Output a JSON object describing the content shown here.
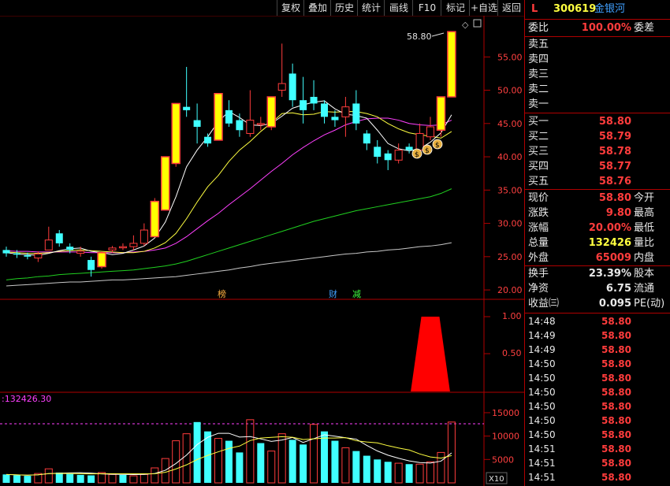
{
  "toolbar": {
    "buttons": [
      "复权",
      "叠加",
      "历史",
      "统计",
      "画线",
      "F10",
      "标记",
      "+自选",
      "返回"
    ]
  },
  "chart": {
    "price_axis": [
      "55.00",
      "50.00",
      "45.00",
      "40.00",
      "35.00",
      "30.00",
      "25.00",
      "20.00"
    ],
    "max_label": "58.80",
    "markers": [
      "榜",
      "财",
      "减"
    ],
    "indicator_axis": [
      "1.00",
      "0.50"
    ],
    "volume_label": ":132426.30",
    "volume_axis": [
      "15000",
      "10000",
      "5000"
    ],
    "volume_unit": "X10",
    "colors": {
      "up": "#ff3c3c",
      "down": "#40ffff",
      "limit_up": "#ffff00",
      "ma5": "#ffffff",
      "ma10": "#ffff40",
      "ma20": "#ff40ff",
      "ma60": "#20d020",
      "ma120": "#c8c8c8"
    }
  },
  "chart_data": {
    "type": "candlestick",
    "y_range": [
      18,
      60
    ],
    "candles": [
      {
        "o": 26.0,
        "c": 25.5,
        "h": 26.5,
        "l": 25.0
      },
      {
        "o": 25.5,
        "c": 25.3,
        "h": 26.0,
        "l": 24.8
      },
      {
        "o": 25.2,
        "c": 25.0,
        "h": 25.6,
        "l": 24.6
      },
      {
        "o": 24.8,
        "c": 25.4,
        "h": 25.8,
        "l": 24.2
      },
      {
        "o": 26.0,
        "c": 27.5,
        "h": 29.5,
        "l": 26.0
      },
      {
        "o": 28.5,
        "c": 27.0,
        "h": 29.0,
        "l": 26.5
      },
      {
        "o": 26.5,
        "c": 26.0,
        "h": 27.0,
        "l": 25.5
      },
      {
        "o": 25.5,
        "c": 25.8,
        "h": 26.5,
        "l": 25.0
      },
      {
        "o": 24.5,
        "c": 23.0,
        "h": 25.0,
        "l": 22.0
      },
      {
        "o": 23.5,
        "c": 25.6,
        "h": 25.8,
        "l": 23.2,
        "limit": true
      },
      {
        "o": 26.0,
        "c": 26.3,
        "h": 26.6,
        "l": 25.6
      },
      {
        "o": 26.5,
        "c": 26.5,
        "h": 27.0,
        "l": 26.0
      },
      {
        "o": 26.5,
        "c": 27.0,
        "h": 28.2,
        "l": 26.0
      },
      {
        "o": 27.0,
        "c": 29.0,
        "h": 30.0,
        "l": 26.6
      },
      {
        "o": 28.0,
        "c": 33.3,
        "h": 33.8,
        "l": 28.0,
        "limit": true
      },
      {
        "o": 32.0,
        "c": 40.0,
        "h": 40.0,
        "l": 32.0,
        "limit": true
      },
      {
        "o": 39.0,
        "c": 48.0,
        "h": 48.0,
        "l": 38.5,
        "limit": true
      },
      {
        "o": 47.5,
        "c": 47.0,
        "h": 53.5,
        "l": 46.0
      },
      {
        "o": 45.5,
        "c": 44.5,
        "h": 48.0,
        "l": 42.0
      },
      {
        "o": 43.0,
        "c": 42.0,
        "h": 43.5,
        "l": 41.5
      },
      {
        "o": 42.5,
        "c": 49.5,
        "h": 49.5,
        "l": 42.5,
        "limit": true
      },
      {
        "o": 47.0,
        "c": 45.0,
        "h": 48.5,
        "l": 44.5
      },
      {
        "o": 45.5,
        "c": 44.0,
        "h": 46.5,
        "l": 43.0
      },
      {
        "o": 43.5,
        "c": 45.5,
        "h": 50.0,
        "l": 43.0
      },
      {
        "o": 45.0,
        "c": 45.0,
        "h": 46.0,
        "l": 44.0
      },
      {
        "o": 44.5,
        "c": 49.0,
        "h": 49.0,
        "l": 44.0,
        "limit": true
      },
      {
        "o": 50.0,
        "c": 51.0,
        "h": 57.0,
        "l": 49.0
      },
      {
        "o": 52.5,
        "c": 48.5,
        "h": 54.0,
        "l": 47.5
      },
      {
        "o": 48.5,
        "c": 47.0,
        "h": 52.0,
        "l": 45.0
      },
      {
        "o": 49.0,
        "c": 48.0,
        "h": 51.5,
        "l": 47.0
      },
      {
        "o": 48.0,
        "c": 46.0,
        "h": 48.5,
        "l": 45.0
      },
      {
        "o": 46.0,
        "c": 45.5,
        "h": 47.0,
        "l": 44.5
      },
      {
        "o": 46.0,
        "c": 47.5,
        "h": 49.0,
        "l": 43.0
      },
      {
        "o": 48.0,
        "c": 45.0,
        "h": 50.0,
        "l": 44.0
      },
      {
        "o": 43.5,
        "c": 42.0,
        "h": 44.0,
        "l": 41.0
      },
      {
        "o": 41.5,
        "c": 40.0,
        "h": 42.5,
        "l": 39.0
      },
      {
        "o": 40.5,
        "c": 39.5,
        "h": 41.0,
        "l": 38.0
      },
      {
        "o": 39.5,
        "c": 41.0,
        "h": 42.0,
        "l": 39.0
      },
      {
        "o": 41.5,
        "c": 41.0,
        "h": 42.0,
        "l": 40.5
      },
      {
        "o": 41.0,
        "c": 43.5,
        "h": 45.0,
        "l": 40.5
      },
      {
        "o": 43.0,
        "c": 44.5,
        "h": 46.0,
        "l": 42.5
      },
      {
        "o": 44.0,
        "c": 49.0,
        "h": 49.0,
        "l": 43.0,
        "limit": true
      },
      {
        "o": 49.0,
        "c": 58.8,
        "h": 58.8,
        "l": 49.0,
        "limit": true
      }
    ],
    "volume_max": 16000,
    "volumes": [
      1800,
      1600,
      1500,
      2000,
      3000,
      2200,
      1900,
      1700,
      1600,
      2200,
      1800,
      1700,
      1500,
      1800,
      3200,
      5200,
      9000,
      10500,
      13000,
      11000,
      9500,
      9000,
      6500,
      13500,
      8500,
      6800,
      10500,
      9200,
      8200,
      12500,
      11000,
      9000,
      7500,
      6800,
      5800,
      5000,
      4500,
      4200,
      4000,
      4000,
      4500,
      6500,
      13000
    ],
    "volume_up": [
      false,
      false,
      false,
      true,
      true,
      false,
      false,
      false,
      false,
      true,
      true,
      false,
      true,
      true,
      true,
      true,
      true,
      true,
      false,
      false,
      true,
      false,
      false,
      true,
      false,
      true,
      true,
      false,
      false,
      true,
      false,
      false,
      true,
      false,
      false,
      false,
      false,
      true,
      false,
      true,
      true,
      true,
      true
    ],
    "ma5": [
      25.6,
      25.4,
      25.3,
      25.2,
      25.5,
      25.9,
      26.2,
      26.3,
      25.8,
      25.6,
      25.3,
      25.5,
      26.0,
      26.6,
      27.8,
      30.2,
      34.0,
      38.5,
      41.0,
      43.0,
      45.3,
      46.8,
      45.9,
      44.8,
      44.7,
      45.0,
      46.1,
      47.3,
      47.8,
      48.2,
      48.4,
      47.2,
      46.4,
      46.2,
      45.8,
      44.0,
      42.0,
      41.2,
      40.9,
      41.2,
      42.2,
      43.6,
      46.3
    ],
    "ma10": [
      25.7,
      25.6,
      25.5,
      25.5,
      25.6,
      25.8,
      25.9,
      26.0,
      25.9,
      25.8,
      25.7,
      25.6,
      25.6,
      25.8,
      26.3,
      27.1,
      28.5,
      30.7,
      33.2,
      35.5,
      37.2,
      39.3,
      41.0,
      42.3,
      43.8,
      45.1,
      46.5,
      46.6,
      46.3,
      46.4,
      46.8,
      46.7,
      46.8,
      46.8,
      46.5,
      46.0,
      45.0,
      44.2,
      43.6,
      43.3,
      43.1,
      42.8,
      43.8
    ],
    "ma20": [
      25.9,
      25.8,
      25.8,
      25.7,
      25.7,
      25.7,
      25.7,
      25.7,
      25.6,
      25.6,
      25.6,
      25.6,
      25.7,
      25.8,
      26.0,
      26.3,
      27.0,
      28.0,
      29.2,
      30.4,
      31.5,
      32.8,
      34.0,
      35.2,
      36.5,
      37.8,
      39.0,
      40.3,
      41.4,
      42.4,
      43.3,
      44.0,
      44.8,
      45.3,
      45.7,
      45.8,
      45.8,
      45.5,
      45.0,
      44.8,
      44.7,
      44.8,
      45.5
    ],
    "ma60": [
      21.5,
      21.7,
      21.8,
      22.0,
      22.1,
      22.3,
      22.4,
      22.5,
      22.6,
      22.7,
      22.8,
      22.9,
      23.0,
      23.2,
      23.4,
      23.6,
      23.9,
      24.3,
      24.8,
      25.3,
      25.8,
      26.3,
      26.8,
      27.3,
      27.8,
      28.3,
      28.8,
      29.3,
      29.8,
      30.3,
      30.7,
      31.1,
      31.5,
      31.9,
      32.2,
      32.5,
      32.8,
      33.1,
      33.4,
      33.7,
      34.0,
      34.5,
      35.2
    ],
    "ma120": [
      20.6,
      20.7,
      20.8,
      20.9,
      21.0,
      21.1,
      21.2,
      21.2,
      21.3,
      21.4,
      21.5,
      21.5,
      21.6,
      21.7,
      21.8,
      21.9,
      22.0,
      22.2,
      22.4,
      22.6,
      22.8,
      23.0,
      23.3,
      23.5,
      23.8,
      24.0,
      24.2,
      24.4,
      24.6,
      24.8,
      25.0,
      25.2,
      25.4,
      25.5,
      25.7,
      25.8,
      26.0,
      26.1,
      26.3,
      26.5,
      26.6,
      26.8,
      27.1
    ],
    "indicator_values": [
      0,
      0,
      0,
      0,
      0,
      0,
      0,
      0,
      0,
      0,
      0,
      0,
      0,
      0,
      0,
      0,
      0,
      0,
      0,
      0,
      0,
      0,
      0,
      0,
      0,
      0,
      0,
      0,
      0,
      0,
      0,
      0,
      0,
      0,
      0,
      0,
      0,
      0,
      0,
      1,
      1,
      1,
      0
    ]
  },
  "quote": {
    "code": "300619",
    "name": "金银河",
    "flag": "L",
    "weibi_label": "委比",
    "weibi_value": "100.00%",
    "weicha_label": "委差",
    "sell_levels": [
      "卖五",
      "卖四",
      "卖三",
      "卖二",
      "卖一"
    ],
    "buy_levels": [
      {
        "label": "买一",
        "price": "58.80"
      },
      {
        "label": "买二",
        "price": "58.79"
      },
      {
        "label": "买三",
        "price": "58.78"
      },
      {
        "label": "买四",
        "price": "58.77"
      },
      {
        "label": "买五",
        "price": "58.76"
      }
    ],
    "stats": [
      {
        "l": "现价",
        "v": "58.80",
        "c": "red",
        "l2": "今开"
      },
      {
        "l": "涨跌",
        "v": "9.80",
        "c": "red",
        "l2": "最高"
      },
      {
        "l": "涨幅",
        "v": "20.00%",
        "c": "red",
        "l2": "最低"
      },
      {
        "l": "总量",
        "v": "132426",
        "c": "yellow",
        "l2": "量比"
      },
      {
        "l": "外盘",
        "v": "65009",
        "c": "red",
        "l2": "内盘"
      }
    ],
    "stats2": [
      {
        "l": "换手",
        "v": "23.39%",
        "l2": "股本"
      },
      {
        "l": "净资",
        "v": "6.75",
        "l2": "流通"
      },
      {
        "l": "收益㈢",
        "v": "0.095",
        "l2": "PE(动)"
      }
    ],
    "ticks": [
      {
        "t": "14:48",
        "p": "58.80"
      },
      {
        "t": "14:49",
        "p": "58.80"
      },
      {
        "t": "14:49",
        "p": "58.80"
      },
      {
        "t": "14:50",
        "p": "58.80"
      },
      {
        "t": "14:50",
        "p": "58.80"
      },
      {
        "t": "14:50",
        "p": "58.80"
      },
      {
        "t": "14:50",
        "p": "58.80"
      },
      {
        "t": "14:50",
        "p": "58.80"
      },
      {
        "t": "14:50",
        "p": "58.80"
      },
      {
        "t": "14:51",
        "p": "58.80"
      },
      {
        "t": "14:51",
        "p": "58.80"
      },
      {
        "t": "14:51",
        "p": "58.80"
      }
    ]
  }
}
